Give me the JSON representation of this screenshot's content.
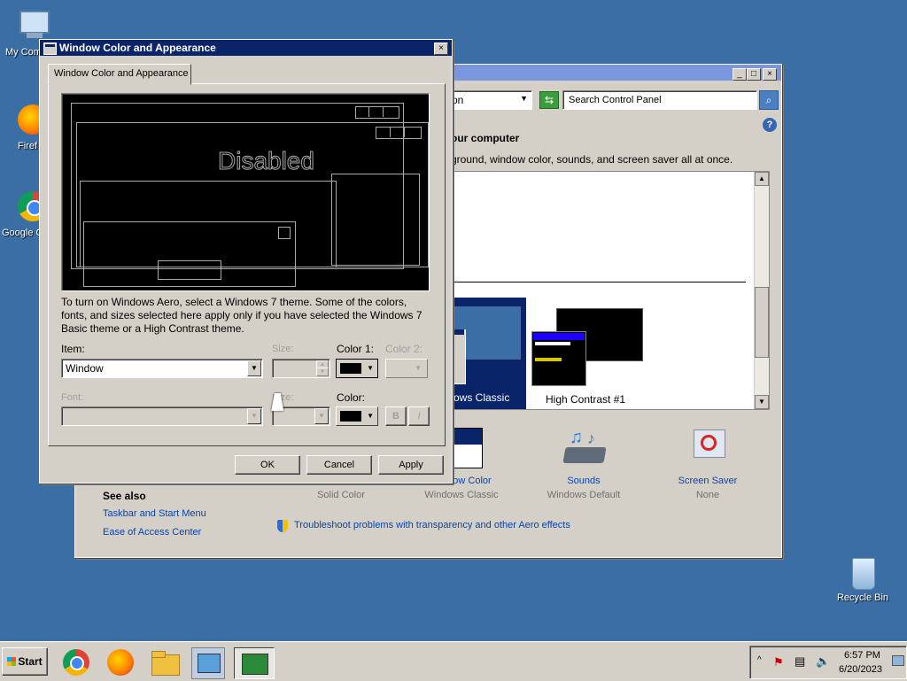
{
  "desktop": {
    "icons": [
      {
        "label": "My Com"
      },
      {
        "label": "Firef"
      },
      {
        "label": "Google C"
      },
      {
        "label": "Recycle Bin"
      }
    ]
  },
  "control_panel": {
    "search_placeholder": "Search Control Panel",
    "address_text": "on",
    "heading": "our computer",
    "subheading": "ground, window color, sounds, and screen saver all at once.",
    "themes": [
      {
        "label": "ows Classic"
      },
      {
        "label": "High Contrast #1"
      }
    ],
    "bottom_items": [
      {
        "title": "",
        "sub": "Solid Color"
      },
      {
        "title": "ow Color",
        "sub": "Windows Classic"
      },
      {
        "title": "Sounds",
        "sub": "Windows Default"
      },
      {
        "title": "Screen Saver",
        "sub": "None"
      }
    ],
    "see_also": {
      "title": "See also",
      "links": [
        "Taskbar and Start Menu",
        "Ease of Access Center"
      ]
    },
    "troubleshoot": "Troubleshoot problems with transparency and other Aero effects"
  },
  "dialog": {
    "title": "Window Color and Appearance",
    "tab": "Window Color and Appearance",
    "preview_disabled": "Disabled",
    "description": "To turn on Windows Aero, select a Windows 7 theme.  Some of the colors, fonts, and sizes selected here apply only if you have selected the Windows 7 Basic theme or a High Contrast theme.",
    "item_label": "Item:",
    "item_value": "Window",
    "size_label": "Size:",
    "color1_label": "Color 1:",
    "color2_label": "Color 2:",
    "font_label": "Font:",
    "size2_label": "Size:",
    "color_label": "Color:",
    "bold_label": "B",
    "italic_label": "I",
    "ok": "OK",
    "cancel": "Cancel",
    "apply": "Apply",
    "close": "x"
  },
  "taskbar": {
    "start": "Start",
    "time": "6:57 PM",
    "date": "6/20/2023"
  },
  "colors": {
    "desktop": "#3a6ea5",
    "chrome": "#d4d0c8",
    "title_active": "#0a246a",
    "title_inactive": "#7a96df",
    "selection": "#0a246a"
  }
}
